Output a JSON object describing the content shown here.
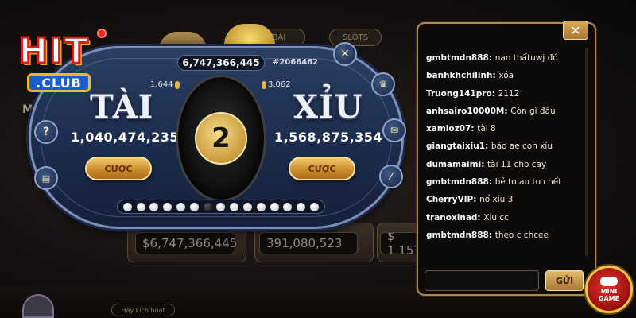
{
  "logo": {
    "title": "HIT",
    "subtitle": ".CLUB"
  },
  "board": {
    "jackpot": "6,747,366,445",
    "session_id": "#2066462",
    "timer": "2",
    "tai": {
      "label": "TÀI",
      "bettors": "1,644",
      "amount": "1,040,474,235",
      "bet_label": "CƯỢC"
    },
    "xiu": {
      "label": "XỈU",
      "bettors": "3,062",
      "amount": "1,568,875,354",
      "bet_label": "CƯỢC"
    },
    "history": [
      "white",
      "white",
      "white",
      "white",
      "white",
      "white",
      "black",
      "white",
      "white",
      "white",
      "white",
      "white",
      "white",
      "white",
      "white",
      "white",
      "white",
      "white",
      "white",
      "white",
      "white",
      "white",
      "white",
      "white",
      "white",
      "white",
      "white",
      "white",
      "white",
      "white"
    ],
    "buttons": {
      "help": "?",
      "close": "✕"
    }
  },
  "background": {
    "tabs": [
      "BÀI",
      "SLOTS"
    ],
    "jackpots": [
      "$6,747,366,445",
      "391,080,523",
      "$ 1,157"
    ],
    "activate_label": "Hãy kích hoạt",
    "left_hint": "MỚ"
  },
  "chat": {
    "messages": [
      {
        "user": "gmbtmdn888",
        "text": "nan thấtuwj đó"
      },
      {
        "user": "banhkhchilinh",
        "text": "xóa"
      },
      {
        "user": "Truong141pro",
        "text": "2112"
      },
      {
        "user": "anhsairo10000M",
        "text": "Còn gì đâu"
      },
      {
        "user": "xamloz07",
        "text": "tài 8"
      },
      {
        "user": "giangtaixiu1",
        "text": "bảo ae con xỉu"
      },
      {
        "user": "dumamaimi",
        "text": "tài 11 cho cay"
      },
      {
        "user": "gmbtmdn888",
        "text": "bẻ to au to chết"
      },
      {
        "user": "CherryVIP",
        "text": "nổ xỉu 3"
      },
      {
        "user": "tranoxinad",
        "text": "Xỉu cc"
      },
      {
        "user": "gmbtmdn888",
        "text": "theo c chcee"
      }
    ],
    "input_placeholder": "",
    "send_label": "GỬI",
    "close_label": "✕"
  },
  "mini_game": {
    "line1": "MINI",
    "line2": "GAME"
  },
  "colors": {
    "accent_gold": "#c99b3c",
    "board_blue": "#1c2c4c",
    "logo_red": "#d71d18"
  }
}
